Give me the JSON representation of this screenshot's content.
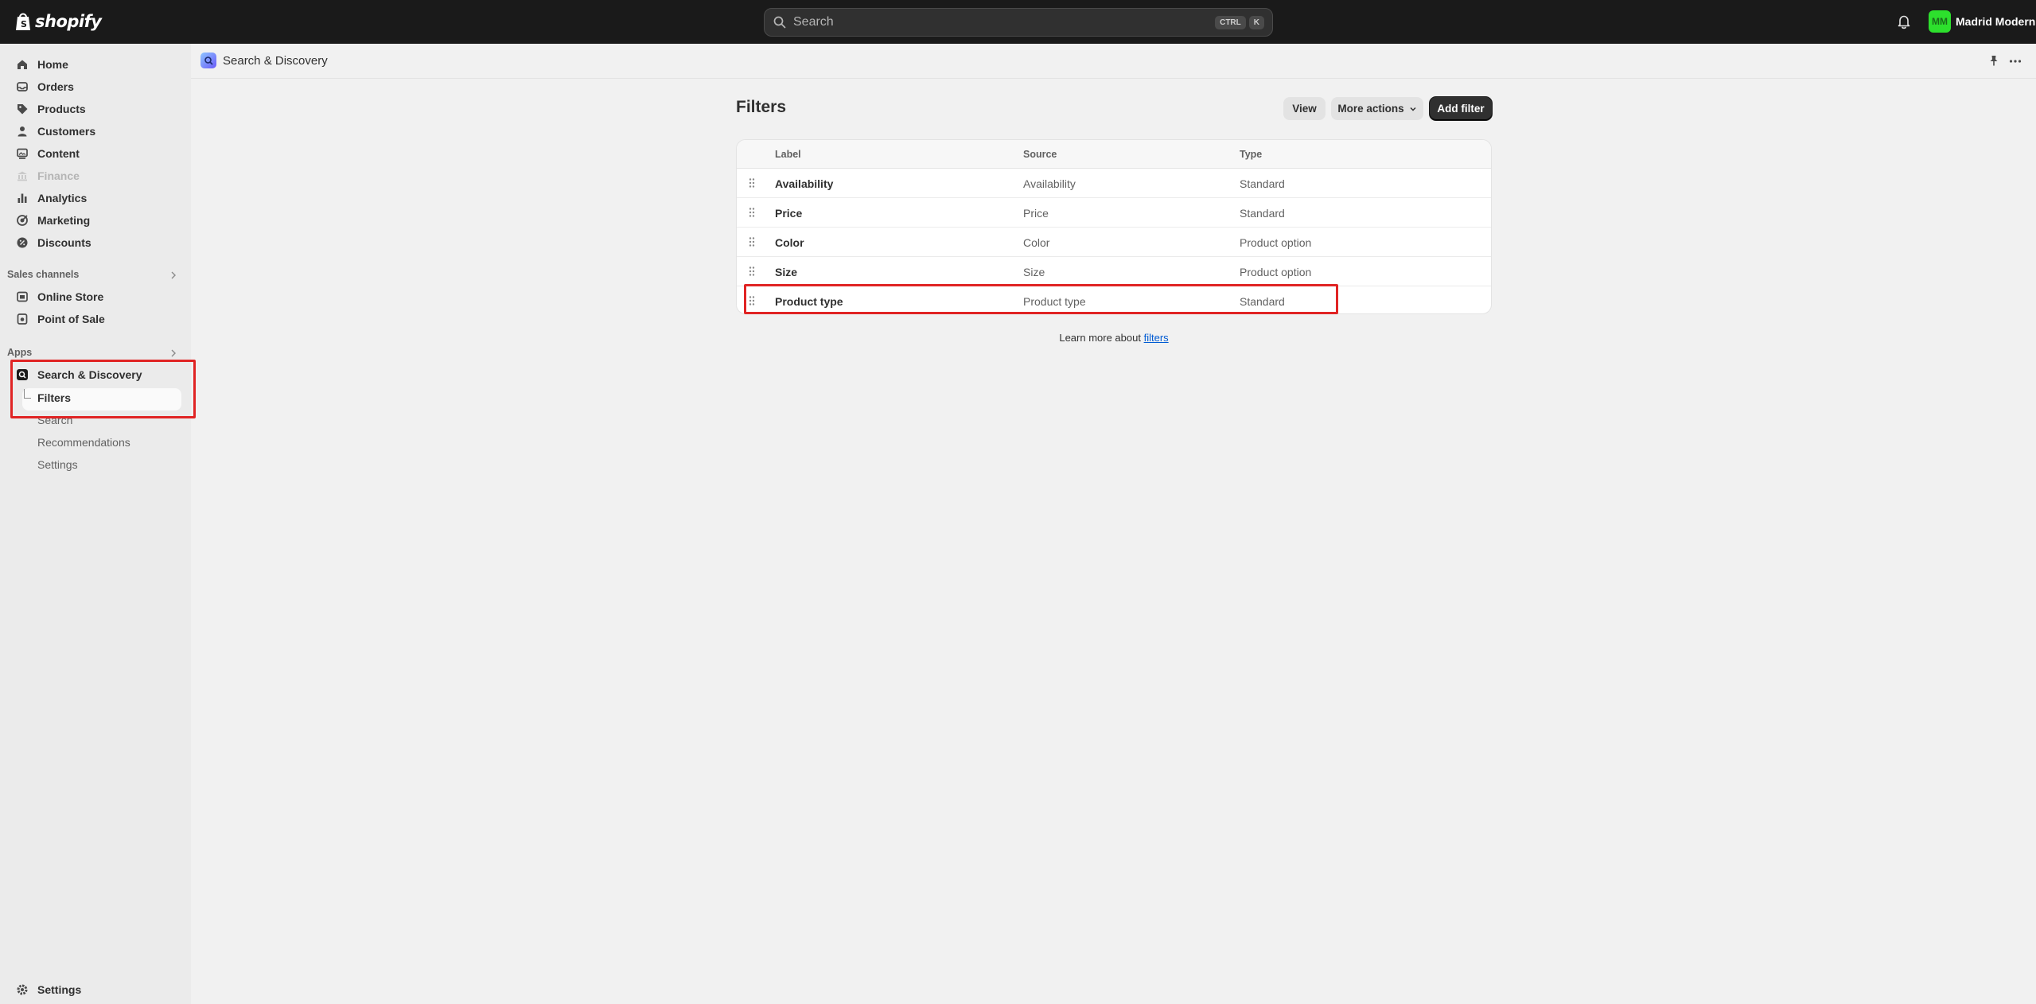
{
  "topbar": {
    "logo_text": "shopify",
    "search_placeholder": "Search",
    "shortcut_keys": [
      "CTRL",
      "K"
    ],
    "avatar_initials": "MM",
    "store_name": "Madrid Modern",
    "avatar_color": "#2de02d"
  },
  "sidebar": {
    "items": [
      {
        "label": "Home",
        "icon": "home-icon"
      },
      {
        "label": "Orders",
        "icon": "inbox-icon"
      },
      {
        "label": "Products",
        "icon": "tag-icon"
      },
      {
        "label": "Customers",
        "icon": "person-icon"
      },
      {
        "label": "Content",
        "icon": "image-icon"
      },
      {
        "label": "Finance",
        "icon": "bank-icon",
        "disabled": true
      },
      {
        "label": "Analytics",
        "icon": "bar-chart-icon"
      },
      {
        "label": "Marketing",
        "icon": "target-icon"
      },
      {
        "label": "Discounts",
        "icon": "discount-icon"
      }
    ],
    "sales_channels_label": "Sales channels",
    "sales_channels": [
      {
        "label": "Online Store",
        "icon": "store-icon"
      },
      {
        "label": "Point of Sale",
        "icon": "pos-icon"
      }
    ],
    "apps_label": "Apps",
    "app": {
      "label": "Search & Discovery",
      "icon": "search-discovery-icon"
    },
    "app_subitems": [
      "Filters",
      "Search",
      "Recommendations",
      "Settings"
    ],
    "settings_label": "Settings"
  },
  "pagebar": {
    "app_title": "Search & Discovery"
  },
  "main": {
    "title": "Filters",
    "buttons": {
      "view": "View",
      "more_actions": "More actions",
      "add_filter": "Add filter"
    },
    "table": {
      "headers": [
        "Label",
        "Source",
        "Type"
      ],
      "rows": [
        {
          "label": "Availability",
          "source": "Availability",
          "type": "Standard"
        },
        {
          "label": "Price",
          "source": "Price",
          "type": "Standard"
        },
        {
          "label": "Color",
          "source": "Color",
          "type": "Product option"
        },
        {
          "label": "Size",
          "source": "Size",
          "type": "Product option"
        },
        {
          "label": "Product type",
          "source": "Product type",
          "type": "Standard"
        }
      ]
    },
    "learn_more_text": "Learn more about",
    "learn_more_link": "filters"
  },
  "colors": {
    "highlight": "#e02424",
    "link": "#005bd3",
    "topbar_bg": "#1a1a1a"
  }
}
